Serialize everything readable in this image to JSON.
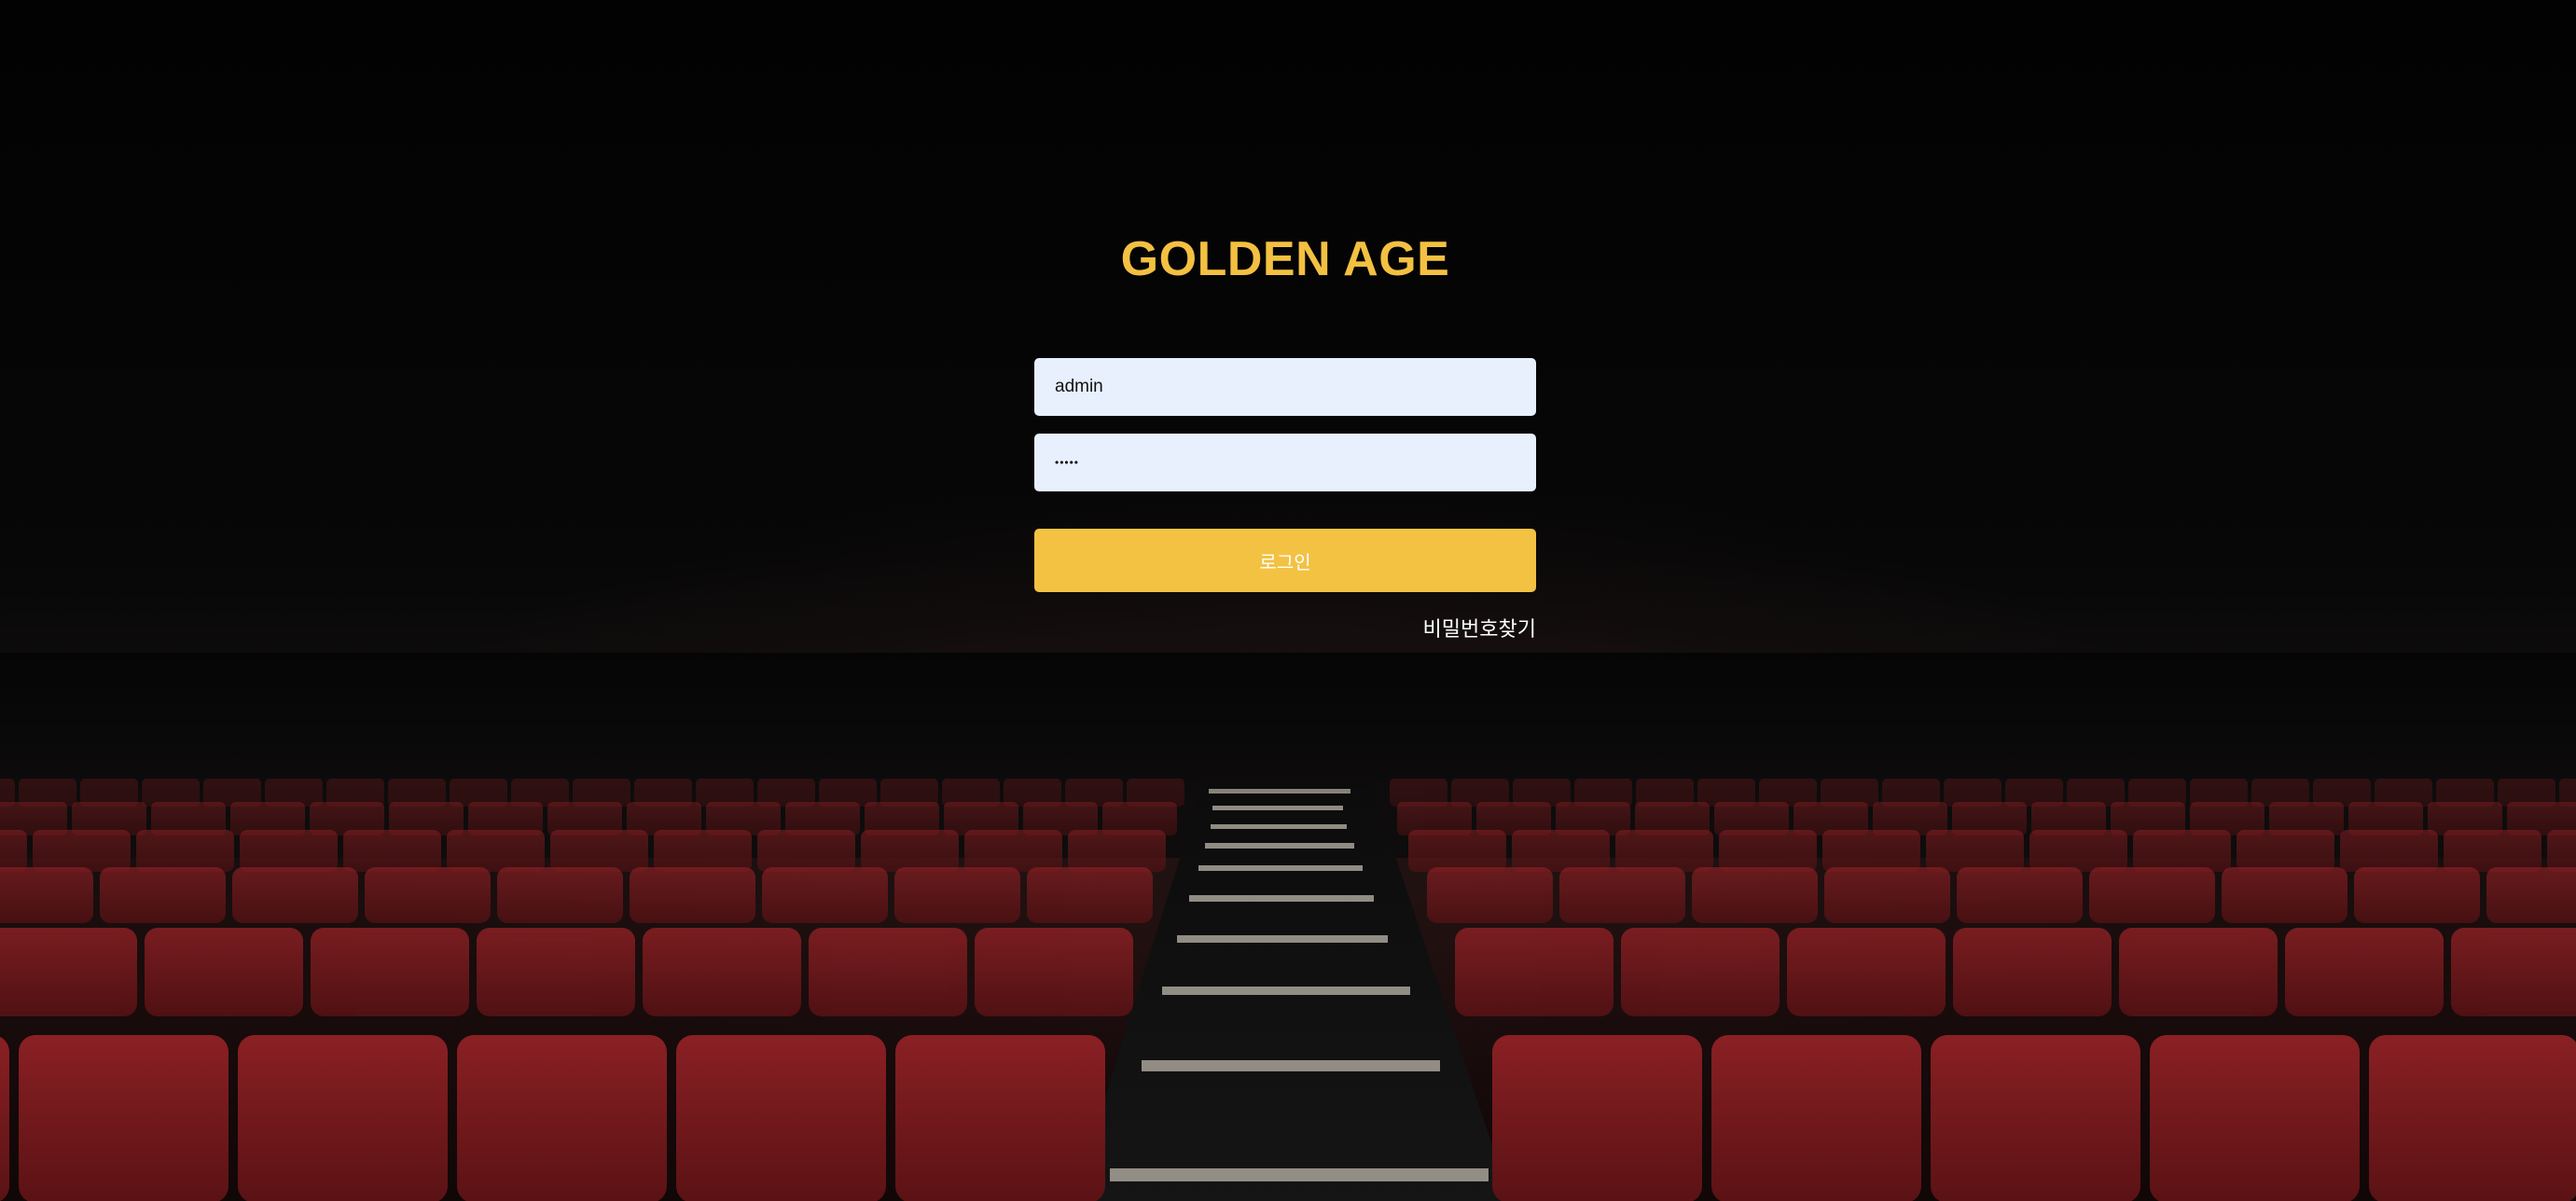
{
  "brand": {
    "title": "GOLDEN AGE",
    "color": "#f3c041"
  },
  "login_form": {
    "username_value": "admin",
    "password_value": "•••••",
    "submit_label": "로그인",
    "find_password_label": "비밀번호찾기"
  },
  "colors": {
    "accent": "#f3c243",
    "input_background": "#e8f0fe",
    "seat_red": "#7a1a1c",
    "background": "#050505"
  }
}
